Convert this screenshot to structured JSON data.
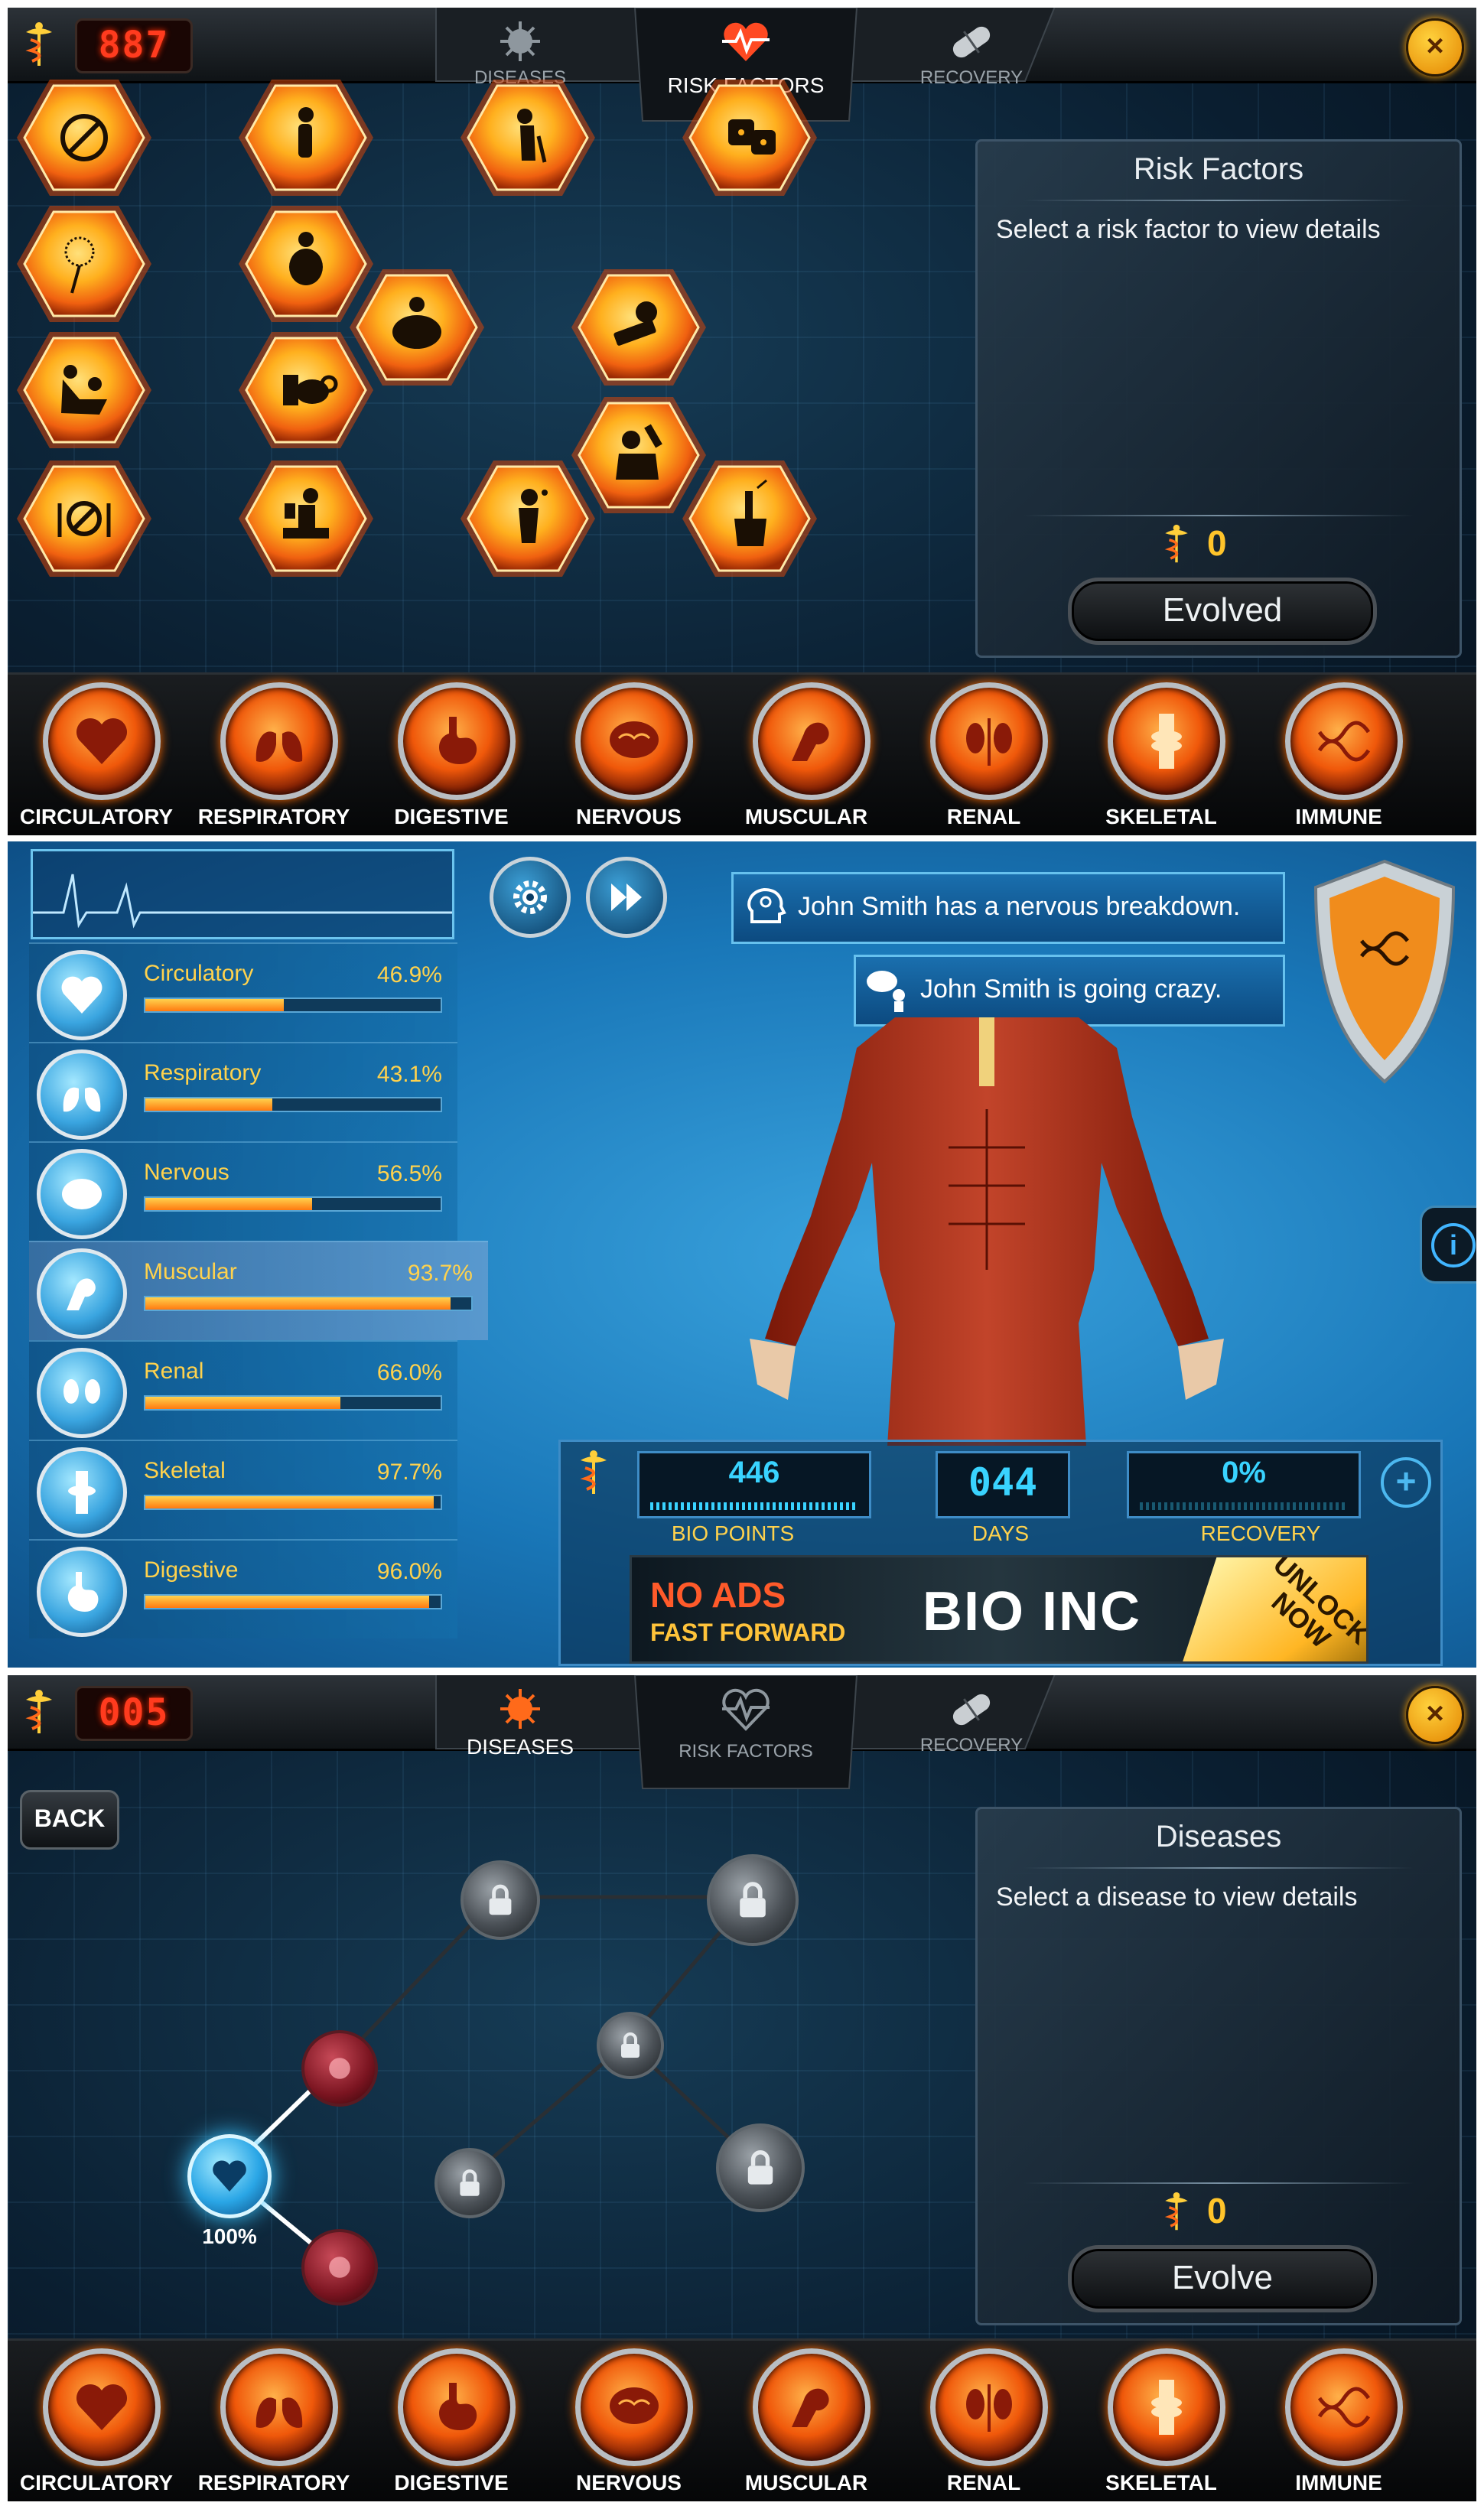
{
  "screen1": {
    "counter": "887",
    "tabs": [
      {
        "label": "DISEASES",
        "icon": "virus-icon",
        "active": false
      },
      {
        "label": "RISK FACTORS",
        "icon": "heartbeat-icon",
        "active": true
      },
      {
        "label": "RECOVERY",
        "icon": "pill-icon",
        "active": false
      }
    ],
    "risk_factor_icons": [
      "pregnancy-icon",
      "slouched-posture-icon",
      "elderly-icon",
      "dice-icon",
      "dandelion-allergy-icon",
      "overweight-icon",
      "obese-icon",
      "toxic-razor-icon",
      "sexual-activity-icon",
      "fast-food-icon",
      "alcohol-icon",
      "no-food-icon",
      "sedentary-work-icon",
      "sick-person-icon",
      "cigarette-hand-icon"
    ],
    "info": {
      "title": "Risk Factors",
      "description": "Select a risk factor to view details",
      "cost": "0",
      "button": "Evolved"
    }
  },
  "systems": [
    {
      "label": "CIRCULATORY",
      "icon": "heart-icon"
    },
    {
      "label": "RESPIRATORY",
      "icon": "lungs-icon"
    },
    {
      "label": "DIGESTIVE",
      "icon": "stomach-icon"
    },
    {
      "label": "NERVOUS",
      "icon": "brain-icon"
    },
    {
      "label": "MUSCULAR",
      "icon": "muscle-arm-icon"
    },
    {
      "label": "RENAL",
      "icon": "kidneys-icon"
    },
    {
      "label": "SKELETAL",
      "icon": "knee-bone-icon"
    },
    {
      "label": "IMMUNE",
      "icon": "dna-icon"
    }
  ],
  "screen2": {
    "stats": [
      {
        "name": "Circulatory",
        "pct": "46.9%",
        "value": 46.9,
        "icon": "heart-icon",
        "selected": false
      },
      {
        "name": "Respiratory",
        "pct": "43.1%",
        "value": 43.1,
        "icon": "lungs-icon",
        "selected": false
      },
      {
        "name": "Nervous",
        "pct": "56.5%",
        "value": 56.5,
        "icon": "brain-icon",
        "selected": false
      },
      {
        "name": "Muscular",
        "pct": "93.7%",
        "value": 93.7,
        "icon": "muscle-arm-icon",
        "selected": true
      },
      {
        "name": "Renal",
        "pct": "66.0%",
        "value": 66.0,
        "icon": "kidneys-icon",
        "selected": false
      },
      {
        "name": "Skeletal",
        "pct": "97.7%",
        "value": 97.7,
        "icon": "knee-bone-icon",
        "selected": false
      },
      {
        "name": "Digestive",
        "pct": "96.0%",
        "value": 96.0,
        "icon": "stomach-icon",
        "selected": false
      }
    ],
    "notifications": [
      "John Smith has a nervous breakdown.",
      "John Smith is going crazy."
    ],
    "bio_points": {
      "value": "446",
      "label": "BIO POINTS"
    },
    "days": {
      "value": "044",
      "label": "DAYS"
    },
    "recovery": {
      "value": "0%",
      "label": "RECOVERY"
    },
    "banner": {
      "line1": "NO ADS",
      "line2": "FAST FORWARD",
      "brand": "BIO INC",
      "cta": "UNLOCK NOW"
    }
  },
  "screen3": {
    "counter": "005",
    "tabs": [
      {
        "label": "DISEASES",
        "icon": "virus-icon",
        "active": true
      },
      {
        "label": "RISK FACTORS",
        "icon": "heartbeat-icon",
        "active": false
      },
      {
        "label": "RECOVERY",
        "icon": "pill-icon",
        "active": false
      }
    ],
    "back_label": "BACK",
    "root_percent": "100%",
    "info": {
      "title": "Diseases",
      "description": "Select a disease to view details",
      "cost": "0",
      "button": "Evolve"
    }
  },
  "colors": {
    "accent_orange": "#ff7a10",
    "accent_yellow": "#ffd24d",
    "accent_cyan": "#39d3ff"
  }
}
